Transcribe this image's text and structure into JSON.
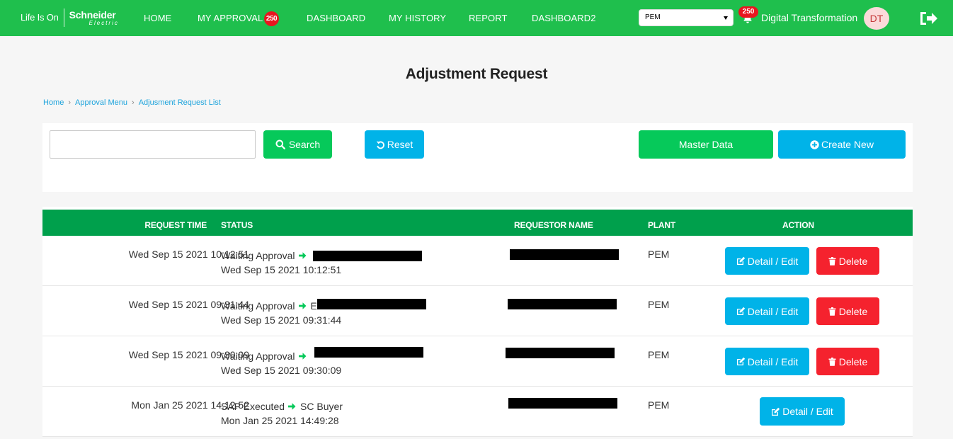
{
  "brand": {
    "life_is_on": "Life Is On",
    "name": "Schneider",
    "sub": "Electric"
  },
  "nav": {
    "home": "HOME",
    "my_approval": "MY APPROVAL",
    "my_approval_badge": "250",
    "dashboard": "DASHBOARD",
    "my_history": "MY HISTORY",
    "report": "REPORT",
    "dashboard2": "DASHBOARD2"
  },
  "plant_select": {
    "value": "PEM"
  },
  "notifications": {
    "count": "250"
  },
  "user": {
    "name": "Digital Transformation",
    "initials": "DT"
  },
  "page": {
    "title": "Adjustment Request"
  },
  "breadcrumb": [
    "Home",
    "Approval Menu",
    "Adjusment Request List"
  ],
  "search": {
    "value": "",
    "search_label": "Search",
    "reset_label": "Reset"
  },
  "actions": {
    "master_data": "Master Data",
    "create_new": "Create New"
  },
  "table": {
    "columns": {
      "request_time": "REQUEST TIME",
      "status": "STATUS",
      "requestor_name": "REQUESTOR NAME",
      "plant": "PLANT",
      "action": "ACTION"
    },
    "rows": [
      {
        "request_time": "Wed Sep 15 2021 10:12:51",
        "status": "Waiting Approval",
        "status_time": "Wed Sep 15 2021 10:12:51",
        "assignee": "",
        "plant": "PEM",
        "edit": "Detail / Edit",
        "delete": "Delete"
      },
      {
        "request_time": "Wed Sep 15 2021 09:31:44",
        "status": "Waiting Approval",
        "status_time": "Wed Sep 15 2021 09:31:44",
        "assignee": "E",
        "plant": "PEM",
        "edit": "Detail / Edit",
        "delete": "Delete"
      },
      {
        "request_time": "Wed Sep 15 2021 09:30:09",
        "status": "Waiting Approval",
        "status_time": "Wed Sep 15 2021 09:30:09",
        "assignee": "",
        "plant": "PEM",
        "edit": "Detail / Edit",
        "delete": "Delete"
      },
      {
        "request_time": "Mon Jan 25 2021 14:12:52",
        "status": "SAP Executed",
        "status_time": "Mon Jan 25 2021 14:49:28",
        "assignee": "SC Buyer",
        "plant": "PEM",
        "edit": "Detail / Edit"
      }
    ]
  },
  "colors": {
    "navbar": "#1fbf4d",
    "table_header": "#00a04c",
    "primary_green": "#06c95a",
    "primary_blue": "#00b3e8",
    "danger_red": "#f5222e",
    "badge_red": "#e8161f",
    "link_blue": "#1ca3dc"
  },
  "icons": [
    "search-icon",
    "reset-icon",
    "plus-circle-icon",
    "edit-icon",
    "trash-icon",
    "arrow-right-icon",
    "bell-icon",
    "logout-icon",
    "caret-down-icon",
    "chevron-right-icon"
  ]
}
